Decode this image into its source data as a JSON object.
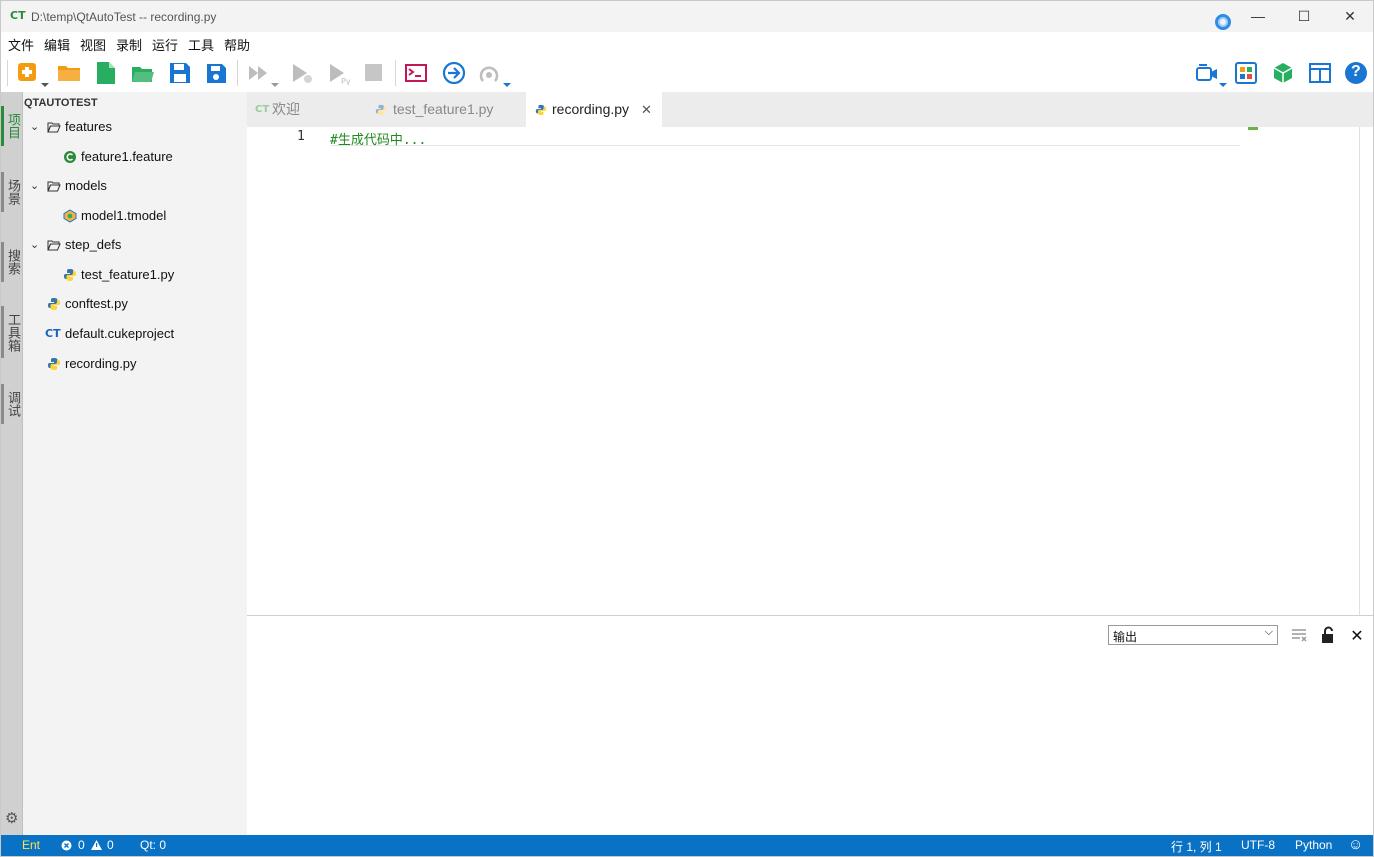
{
  "window": {
    "logo": "CT",
    "title": "D:\\temp\\QtAutoTest -- recording.py",
    "minimize": "—",
    "maximize": "☐",
    "close": "✕"
  },
  "menu": [
    "文件",
    "编辑",
    "视图",
    "录制",
    "运行",
    "工具",
    "帮助"
  ],
  "toolbar": {
    "left_icons": [
      "new-icon",
      "open-folder-icon",
      "new-file-icon",
      "open-file-icon",
      "save-icon",
      "save-all-icon",
      "run-all-icon",
      "run-scenario-icon",
      "run-python-icon",
      "stop-icon",
      "terminal-icon",
      "go-icon",
      "record-icon"
    ],
    "right_icons": [
      "record-video-icon",
      "layout-grid-icon",
      "cube-icon",
      "panel-layout-icon",
      "help-icon"
    ],
    "help_label": "?"
  },
  "activity_bar": {
    "tabs": [
      "项目",
      "场景",
      "搜索",
      "工具箱",
      "调试"
    ],
    "settings_icon": "⚙"
  },
  "project": {
    "header": "QTAUTOTEST",
    "items": [
      {
        "label": "features",
        "type": "folder"
      },
      {
        "label": "feature1.feature",
        "type": "feature"
      },
      {
        "label": "models",
        "type": "folder"
      },
      {
        "label": "model1.tmodel",
        "type": "model"
      },
      {
        "label": "step_defs",
        "type": "folder"
      },
      {
        "label": "test_feature1.py",
        "type": "python"
      },
      {
        "label": "conftest.py",
        "type": "python"
      },
      {
        "label": "default.cukeproject",
        "type": "project"
      },
      {
        "label": "recording.py",
        "type": "python"
      }
    ]
  },
  "tabs": [
    {
      "label": "欢迎",
      "active": false
    },
    {
      "label": "test_feature1.py",
      "active": false
    },
    {
      "label": "recording.py",
      "active": true,
      "close": "✕"
    }
  ],
  "editor": {
    "line_number": "1",
    "code": "#生成代码中..."
  },
  "output": {
    "selected": "输出",
    "caret": "⌵",
    "close": "✕"
  },
  "statusbar": {
    "mode": "Ent",
    "errors": "0",
    "warnings": "0",
    "qt": "Qt: 0",
    "position": "行 1, 列 1",
    "encoding": "UTF-8",
    "language": "Python",
    "feedback_icon": "☺"
  },
  "colors": {
    "accent_green": "#2a8a3a",
    "status_blue": "#0a72c4",
    "toolbar_orange": "#f39c12",
    "toolbar_green": "#27ae60",
    "toolbar_blue": "#1976d2"
  }
}
